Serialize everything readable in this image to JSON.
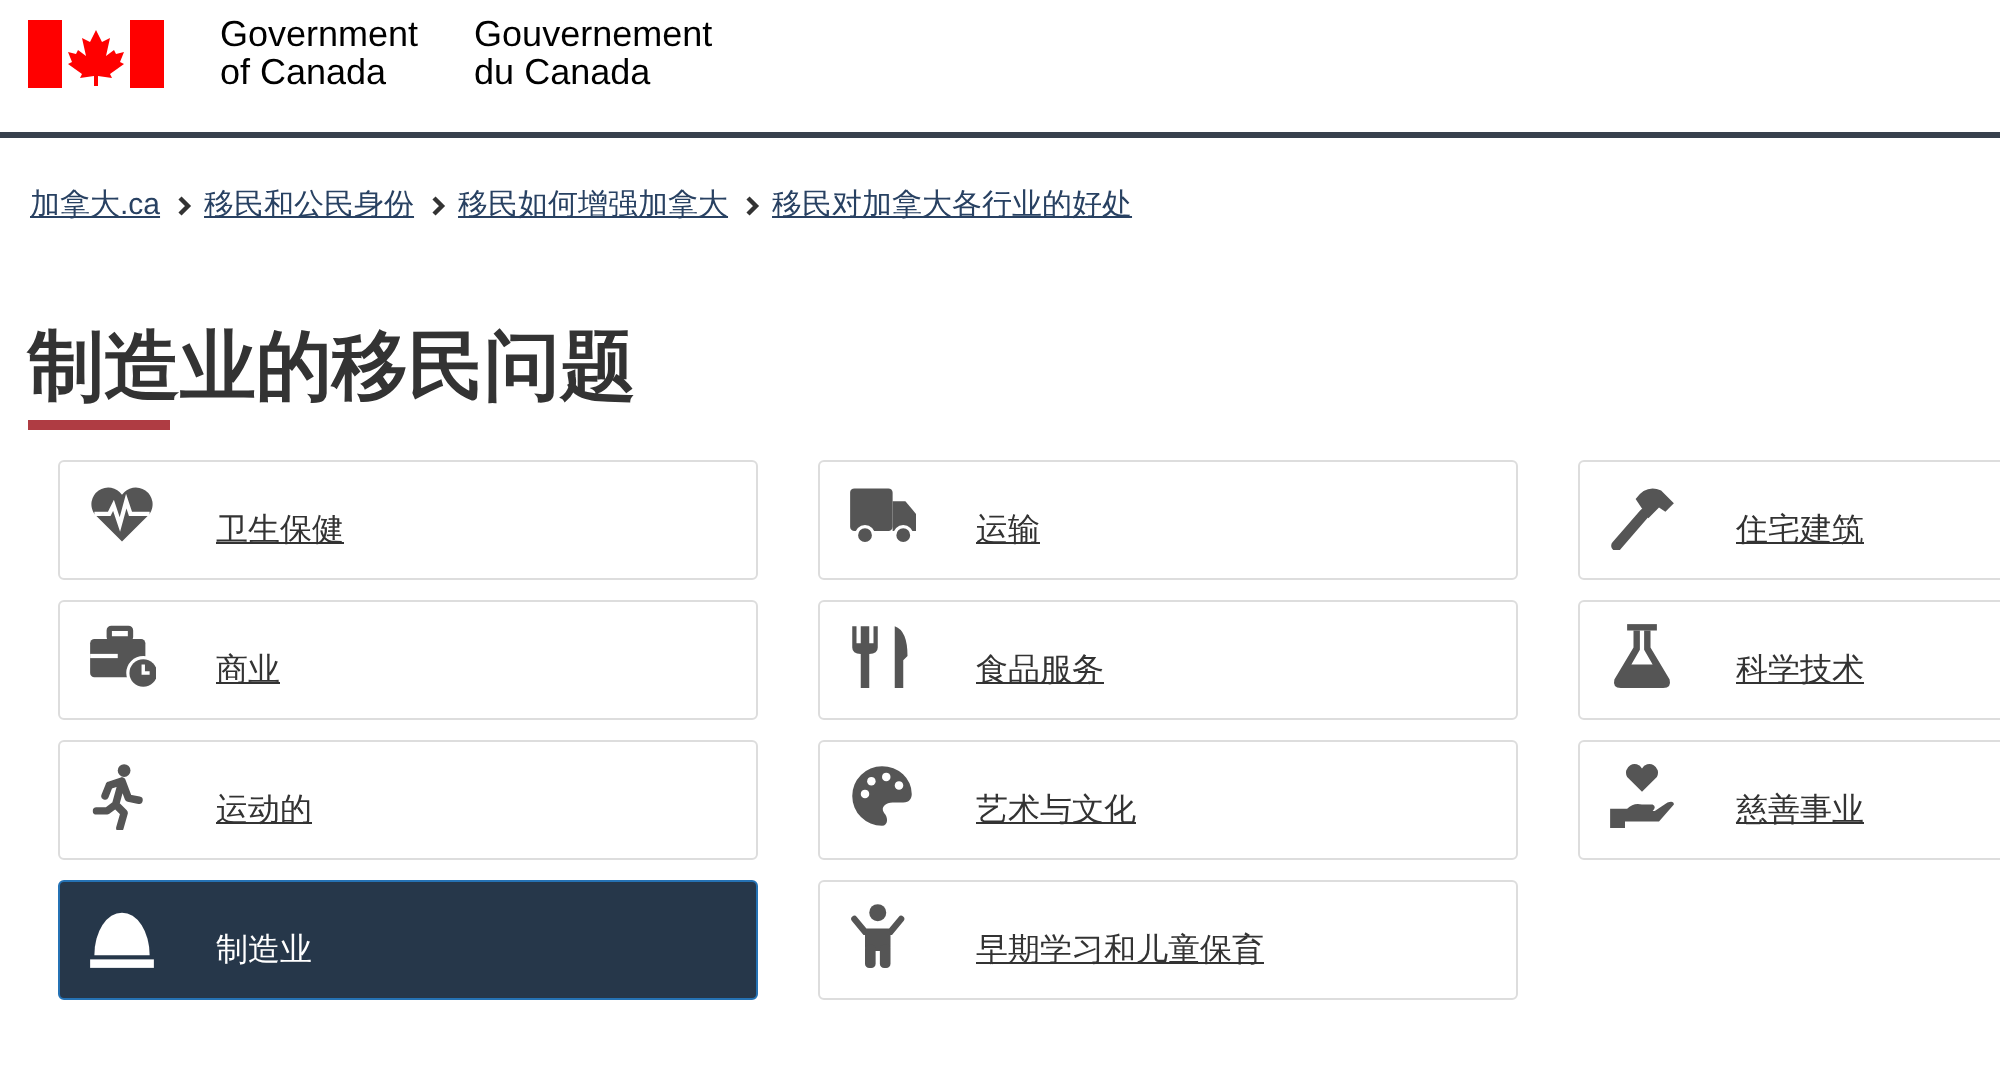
{
  "header": {
    "name_en": [
      "Government",
      "of Canada"
    ],
    "name_fr": [
      "Gouvernement",
      "du Canada"
    ]
  },
  "breadcrumbs": [
    "加拿大.ca",
    "移民和公民身份",
    "移民如何增强加拿大",
    "移民对加拿大各行业的好处"
  ],
  "title": "制造业的移民问题",
  "columns": [
    [
      {
        "label": "卫生保健",
        "kind": "heart",
        "selected": false
      },
      {
        "label": "商业",
        "kind": "briefcase",
        "selected": false
      },
      {
        "label": "运动的",
        "kind": "runner",
        "selected": false
      },
      {
        "label": "制造业",
        "kind": "helmet",
        "selected": true
      }
    ],
    [
      {
        "label": "运输",
        "kind": "truck",
        "selected": false
      },
      {
        "label": "食品服务",
        "kind": "utensils",
        "selected": false
      },
      {
        "label": "艺术与文化",
        "kind": "palette",
        "selected": false
      },
      {
        "label": "早期学习和儿童保育",
        "kind": "child",
        "selected": false
      }
    ],
    [
      {
        "label": "住宅建筑",
        "kind": "hammer",
        "selected": false
      },
      {
        "label": "科学技术",
        "kind": "flask",
        "selected": false
      },
      {
        "label": "慈善事业",
        "kind": "hand-heart",
        "selected": false
      }
    ]
  ]
}
